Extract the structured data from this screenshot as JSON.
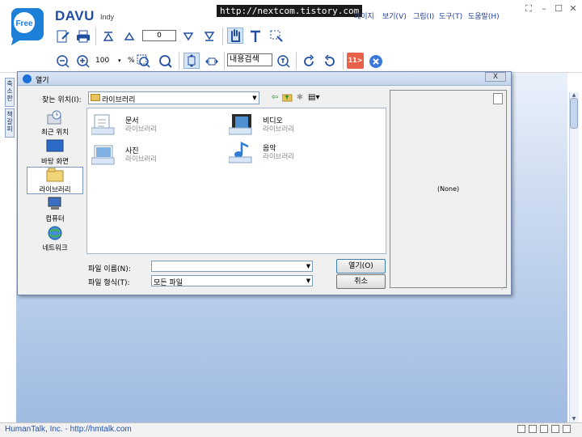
{
  "app": {
    "name": "DAVU",
    "edition": "Indy",
    "logo_text": "Free"
  },
  "overlay": {
    "url": "http://nextcom.tistory.com"
  },
  "menu": {
    "items": [
      {
        "label": "페이지"
      },
      {
        "label": "보기(V)"
      },
      {
        "label": "그림(I)"
      },
      {
        "label": "도구(T)"
      },
      {
        "label": "도움말(H)"
      }
    ]
  },
  "toolbar": {
    "page_number": "0",
    "zoom_value": "100",
    "zoom_unit": "%",
    "search_value": "내용검색",
    "page_badge": "11"
  },
  "side_tabs": [
    {
      "label": "축소판"
    },
    {
      "label": "책갈피"
    }
  ],
  "status": {
    "text": "HumanTalk, Inc. - http://hmtalk.com"
  },
  "dialog": {
    "title": "열기",
    "close_label": "X",
    "lookin_label": "찾는 위치(I):",
    "lookin_value": "라이브러리",
    "places": [
      {
        "label": "최근 위치",
        "icon": "recent-places-icon"
      },
      {
        "label": "바탕 화면",
        "icon": "desktop-icon"
      },
      {
        "label": "라이브러리",
        "icon": "libraries-icon",
        "selected": true
      },
      {
        "label": "컴퓨터",
        "icon": "computer-icon"
      },
      {
        "label": "네트워크",
        "icon": "network-icon"
      }
    ],
    "files": [
      {
        "name": "문서",
        "type": "라이브러리",
        "icon": "documents-library-icon"
      },
      {
        "name": "비디오",
        "type": "라이브러리",
        "icon": "videos-library-icon"
      },
      {
        "name": "사진",
        "type": "라이브러리",
        "icon": "pictures-library-icon"
      },
      {
        "name": "음악",
        "type": "라이브러리",
        "icon": "music-library-icon"
      }
    ],
    "preview_text": "(None)",
    "filename_label": "파일 이름(N):",
    "filename_value": "",
    "filetype_label": "파일 형식(T):",
    "filetype_value": "모든 파일",
    "open_button": "열기(O)",
    "cancel_button": "취소"
  },
  "colors": {
    "accent": "#1f4ea3",
    "workspace_top": "#eaf1fb",
    "workspace_bottom": "#9fbbe2",
    "badge": "#e8614b"
  }
}
